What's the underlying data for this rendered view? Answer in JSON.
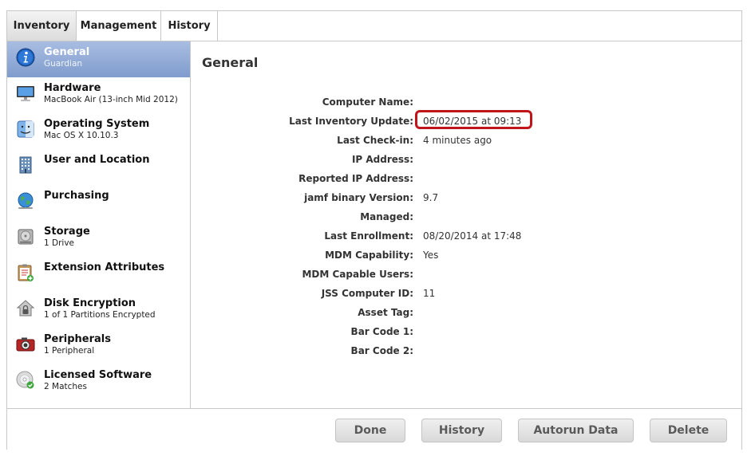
{
  "tabs": [
    {
      "label": "Inventory",
      "active": true
    },
    {
      "label": "Management",
      "active": false
    },
    {
      "label": "History",
      "active": false
    }
  ],
  "sidebar": {
    "items": [
      {
        "title": "General",
        "subtitle": "Guardian",
        "icon": "info-icon",
        "selected": true
      },
      {
        "title": "Hardware",
        "subtitle": "MacBook Air (13-inch Mid 2012)",
        "icon": "monitor-icon"
      },
      {
        "title": "Operating System",
        "subtitle": "Mac OS X 10.10.3",
        "icon": "finder-icon"
      },
      {
        "title": "User and Location",
        "subtitle": "",
        "icon": "building-icon"
      },
      {
        "title": "Purchasing",
        "subtitle": "",
        "icon": "globe-icon"
      },
      {
        "title": "Storage",
        "subtitle": "1 Drive",
        "icon": "hard-drive-icon"
      },
      {
        "title": "Extension Attributes",
        "subtitle": "",
        "icon": "clipboard-icon"
      },
      {
        "title": "Disk Encryption",
        "subtitle": "1 of 1 Partitions Encrypted",
        "icon": "lock-house-icon"
      },
      {
        "title": "Peripherals",
        "subtitle": "1 Peripheral",
        "icon": "camera-icon"
      },
      {
        "title": "Licensed Software",
        "subtitle": "2 Matches",
        "icon": "disc-icon"
      }
    ]
  },
  "main": {
    "title": "General",
    "fields": [
      {
        "label": "Computer Name:",
        "value": ""
      },
      {
        "label": "Last Inventory Update:",
        "value": "06/02/2015 at 09:13",
        "highlighted": true
      },
      {
        "label": "Last Check-in:",
        "value": "4 minutes ago"
      },
      {
        "label": "IP Address:",
        "value": ""
      },
      {
        "label": "Reported IP Address:",
        "value": ""
      },
      {
        "label": "jamf binary Version:",
        "value": "9.7"
      },
      {
        "label": "Managed:",
        "value": ""
      },
      {
        "label": "Last Enrollment:",
        "value": "08/20/2014 at 17:48"
      },
      {
        "label": "MDM Capability:",
        "value": "Yes"
      },
      {
        "label": "MDM Capable Users:",
        "value": ""
      },
      {
        "label": "JSS Computer ID:",
        "value": "11"
      },
      {
        "label": "Asset Tag:",
        "value": ""
      },
      {
        "label": "Bar Code 1:",
        "value": ""
      },
      {
        "label": "Bar Code 2:",
        "value": ""
      }
    ]
  },
  "footer": {
    "done_label": "Done",
    "history_label": "History",
    "autorun_label": "Autorun Data",
    "delete_label": "Delete"
  },
  "colors": {
    "selection": "#8fa8d6",
    "highlight_border": "#c0151b"
  }
}
